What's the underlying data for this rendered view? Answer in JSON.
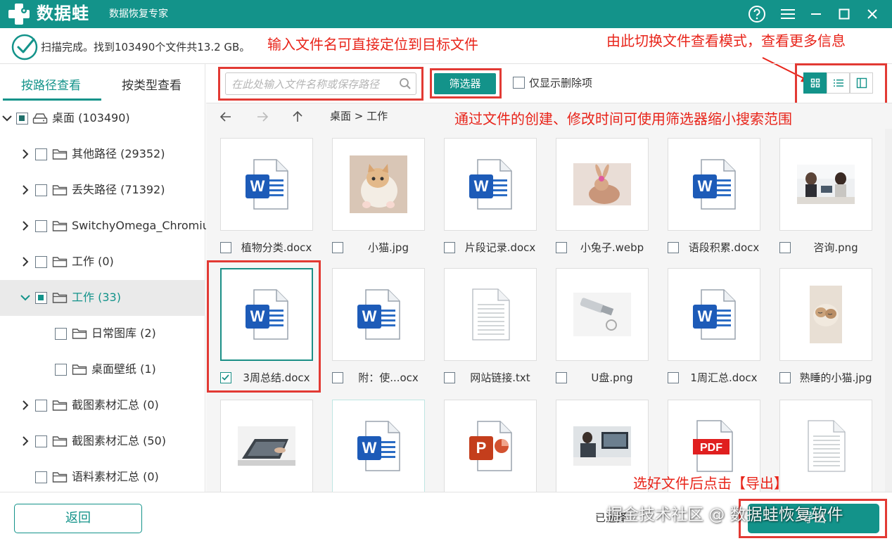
{
  "app": {
    "name": "数据蛙",
    "subtitle": "数据恢复专家",
    "brand_color": "#13938a"
  },
  "titlebar": {
    "buttons": [
      "help-icon",
      "menu-icon",
      "minimize-icon",
      "maximize-icon",
      "close-icon"
    ]
  },
  "status": {
    "text": "扫描完成。找到103490个文件共13.2 GB。",
    "icon": "check-circle-icon"
  },
  "annotations": {
    "search_hint": "输入文件名可直接定位到目标文件",
    "view_hint": "由此切换文件查看模式，查看更多信息",
    "filter_hint": "通过文件的创建、修改时间可使用筛选器缩小搜索范围",
    "export_hint": "选好文件后点击【导出】",
    "color": "#e8241a"
  },
  "sidebar": {
    "tabs": [
      {
        "label": "按路径查看",
        "active": true
      },
      {
        "label": "按类型查看",
        "active": false
      }
    ],
    "tree": [
      {
        "label": "桌面 (103490)",
        "expanded": true,
        "checkbox": "partial",
        "level": 0,
        "icon": "drive-icon"
      },
      {
        "label": "其他路径 (29352)",
        "expanded": false,
        "checkbox": "none",
        "level": 1,
        "icon": "folder-icon"
      },
      {
        "label": "丢失路径 (71392)",
        "expanded": false,
        "checkbox": "none",
        "level": 1,
        "icon": "folder-icon"
      },
      {
        "label": "SwitchyOmega_Chromium",
        "expanded": false,
        "checkbox": "none",
        "level": 1,
        "icon": "folder-icon"
      },
      {
        "label": "工作 (0)",
        "expanded": false,
        "checkbox": "none",
        "level": 1,
        "icon": "folder-icon"
      },
      {
        "label": "工作 (33)",
        "expanded": true,
        "checkbox": "partial",
        "level": 1,
        "icon": "folder-icon",
        "selected": true
      },
      {
        "label": "日常图库 (2)",
        "expanded": null,
        "checkbox": "none",
        "level": 2,
        "icon": "folder-icon"
      },
      {
        "label": "桌面壁纸 (1)",
        "expanded": null,
        "checkbox": "none",
        "level": 2,
        "icon": "folder-icon"
      },
      {
        "label": "截图素材汇总 (0)",
        "expanded": false,
        "checkbox": "none",
        "level": 1,
        "icon": "folder-icon"
      },
      {
        "label": "截图素材汇总 (50)",
        "expanded": false,
        "checkbox": "none",
        "level": 1,
        "icon": "folder-icon"
      },
      {
        "label": "语料素材汇总 (0)",
        "expanded": null,
        "checkbox": "none",
        "level": 1,
        "icon": "folder-icon"
      }
    ]
  },
  "toolbar": {
    "search_placeholder": "在此处输入文件名称或保存路径",
    "search_value": "",
    "filter_label": "筛选器",
    "only_deleted_label": "仅显示删除项",
    "only_deleted_checked": false,
    "view_modes": [
      {
        "name": "grid-view-icon",
        "active": true
      },
      {
        "name": "list-view-icon",
        "active": false
      },
      {
        "name": "detail-view-icon",
        "active": false
      }
    ]
  },
  "nav": {
    "back_icon": "arrow-left-icon",
    "forward_icon": "arrow-right-icon",
    "up_icon": "arrow-up-icon",
    "breadcrumb": "桌面 > 工作"
  },
  "files": [
    {
      "name": "植物分类.docx",
      "type": "word",
      "checked": false
    },
    {
      "name": "小猫.jpg",
      "type": "photo-kitten",
      "checked": false
    },
    {
      "name": "片段记录.docx",
      "type": "word",
      "checked": false
    },
    {
      "name": "小兔子.webp",
      "type": "photo-rabbit",
      "checked": false
    },
    {
      "name": "语段积累.docx",
      "type": "word",
      "checked": false
    },
    {
      "name": "咨询.png",
      "type": "photo-office",
      "checked": false
    },
    {
      "name": "3周总结.docx",
      "type": "word",
      "checked": true,
      "selected": true
    },
    {
      "name": "附：使...ocx",
      "type": "word",
      "checked": false
    },
    {
      "name": "网站链接.txt",
      "type": "text",
      "checked": false
    },
    {
      "name": "U盘.png",
      "type": "photo-usb",
      "checked": false
    },
    {
      "name": "1周汇总.docx",
      "type": "word",
      "checked": false
    },
    {
      "name": "熟睡的小猫.jpg",
      "type": "photo-sleeping-cat",
      "checked": false
    },
    {
      "name": "",
      "type": "photo-laptop",
      "checked": false
    },
    {
      "name": "",
      "type": "word",
      "checked": false,
      "hover": true
    },
    {
      "name": "",
      "type": "powerpoint",
      "checked": false
    },
    {
      "name": "",
      "type": "photo-desk",
      "checked": false
    },
    {
      "name": "",
      "type": "pdf",
      "checked": false
    },
    {
      "name": "",
      "type": "text",
      "checked": false
    }
  ],
  "footer": {
    "back_label": "返回",
    "selected_text": "已选择",
    "export_label": "导出",
    "watermark": "掘金技术社区 @ 数据蛙恢复软件"
  }
}
